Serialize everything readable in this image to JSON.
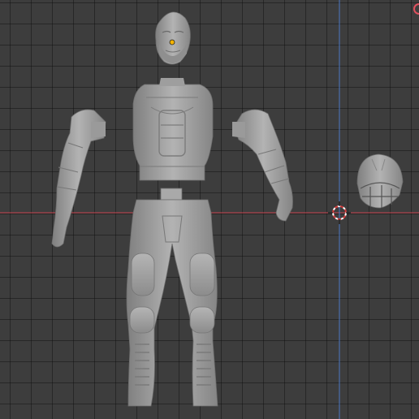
{
  "viewport": {
    "background": "#3d3d3d",
    "grid_color": "#2a2a2a",
    "x_axis_color": "#c8444e",
    "y_axis_color": "#4a78c4",
    "model_color": "#a7a7a7",
    "origin_color": "#f5b400",
    "cursor_icon": "3d-cursor-icon",
    "gizmo_icon": "navigation-gizmo-x-icon"
  },
  "objects": [
    {
      "name": "head"
    },
    {
      "name": "torso"
    },
    {
      "name": "left-arm"
    },
    {
      "name": "right-arm"
    },
    {
      "name": "pelvis-and-legs"
    },
    {
      "name": "football-helmet"
    }
  ]
}
